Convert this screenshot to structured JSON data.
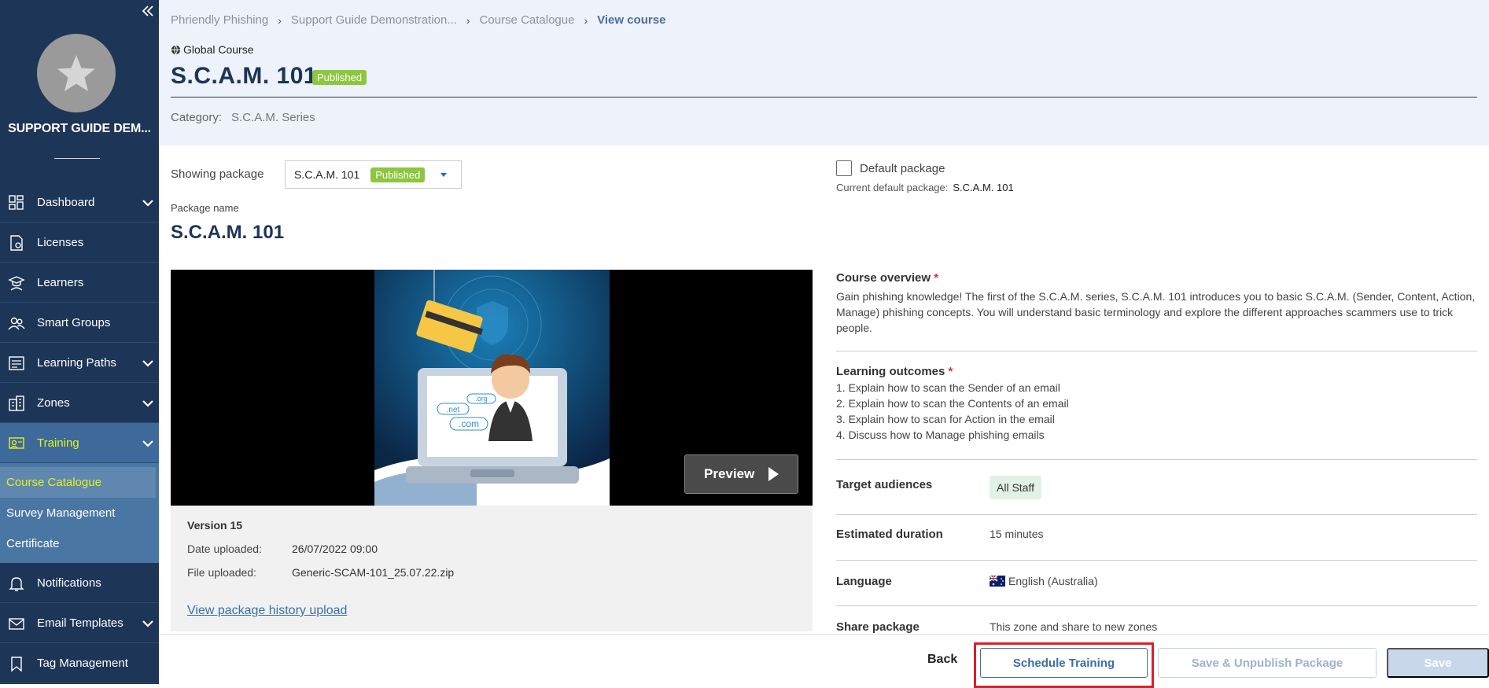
{
  "sidebar": {
    "org_name": "SUPPORT GUIDE DEM...",
    "items": [
      {
        "label": "Dashboard",
        "icon": "dashboard-grid-icon",
        "has_children": true
      },
      {
        "label": "Licenses",
        "icon": "license-document-icon",
        "has_children": false
      },
      {
        "label": "Learners",
        "icon": "learner-graduate-icon",
        "has_children": false
      },
      {
        "label": "Smart Groups",
        "icon": "users-group-icon",
        "has_children": false
      },
      {
        "label": "Learning Paths",
        "icon": "learning-path-icon",
        "has_children": true
      },
      {
        "label": "Zones",
        "icon": "buildings-icon",
        "has_children": true
      },
      {
        "label": "Training",
        "icon": "training-icon",
        "has_children": true,
        "active": true
      },
      {
        "label": "Notifications",
        "icon": "bell-icon",
        "has_children": false
      },
      {
        "label": "Email Templates",
        "icon": "email-icon",
        "has_children": true
      },
      {
        "label": "Tag Management",
        "icon": "bookmark-icon",
        "has_children": false
      }
    ],
    "training_sub": [
      {
        "label": "Course Catalogue",
        "active": true
      },
      {
        "label": "Survey Management",
        "active": false
      },
      {
        "label": "Certificate",
        "active": false
      }
    ]
  },
  "breadcrumb": [
    "Phriendly Phishing",
    "Support Guide Demonstration...",
    "Course Catalogue",
    "View course"
  ],
  "course": {
    "scope": "Global Course",
    "title": "S.C.A.M. 101",
    "status": "Published",
    "category_label": "Category:",
    "category": "S.C.A.M. Series"
  },
  "package": {
    "showing_label": "Showing package",
    "selected": "S.C.A.M. 101",
    "selected_status": "Published",
    "name_label": "Package name",
    "name": "S.C.A.M. 101",
    "default_label": "Default package",
    "default_checked": false,
    "current_default_label": "Current default package:",
    "current_default": "S.C.A.M. 101"
  },
  "video": {
    "preview_label": "Preview",
    "version": "Version 15",
    "date_label": "Date uploaded:",
    "date": "26/07/2022 09:00",
    "file_label": "File uploaded:",
    "file": "Generic-SCAM-101_25.07.22.zip",
    "history_link": "View package history upload",
    "thumb_tags": [
      ".org",
      ".net",
      ".com"
    ]
  },
  "details": {
    "overview_label": "Course overview",
    "overview": "Gain phishing knowledge! The first of the S.C.A.M. series, S.C.A.M. 101 introduces you to basic S.C.A.M. (Sender, Content, Action, Manage) phishing concepts. You will understand basic terminology and explore the different approaches scammers use to trick people.",
    "outcomes_label": "Learning outcomes",
    "outcomes": [
      "1. Explain how to scan the Sender of an email",
      "2. Explain how to scan the Contents of an email",
      "3. Explain how to scan for Action in the email",
      "4. Discuss how to Manage phishing emails"
    ],
    "audience_label": "Target audiences",
    "audience": "All Staff",
    "duration_label": "Estimated duration",
    "duration": "15 minutes",
    "language_label": "Language",
    "language": "English (Australia)",
    "share_label": "Share package",
    "share": "This zone and share to new zones"
  },
  "footer": {
    "back": "Back",
    "schedule": "Schedule Training",
    "unpublish": "Save & Unpublish Package",
    "save": "Save"
  },
  "colors": {
    "sidebar_bg": "#1d3557",
    "active_text": "#e3f21b",
    "published_badge": "#8dc63f",
    "highlight_box": "#d9202b",
    "link": "#3b6fa5"
  }
}
